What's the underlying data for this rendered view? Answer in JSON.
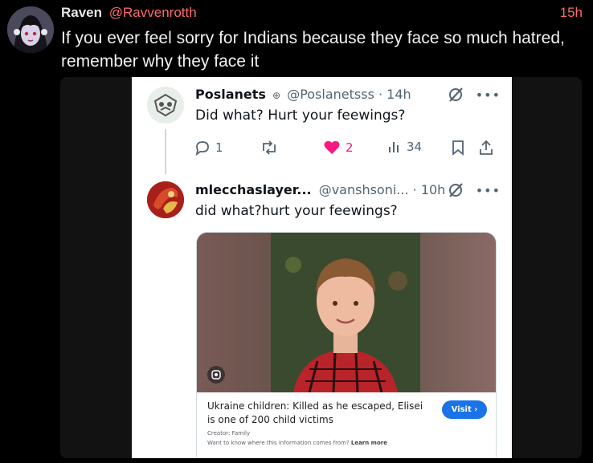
{
  "post": {
    "author_name": "Raven",
    "author_handle": "@Ravvenrotth",
    "time": "15h",
    "text": "If you ever feel sorry for Indians because they face so much hatred, remember why they face it"
  },
  "embedded_screenshot": {
    "tweet1": {
      "name": "Poslanets",
      "handle": "@Poslanetsss · 14h",
      "text": "Did what? Hurt your feewings?",
      "replies": "1",
      "likes": "2",
      "views": "34"
    },
    "tweet2": {
      "name": "mlecchaslayer...",
      "handle": "@vanshsoni... · 10h",
      "text": "did what?hurt your feewings?"
    },
    "card": {
      "caption": "Ukraine children: Killed as he escaped, Elisei is one of 200 child victims",
      "visit_label": "Visit ›",
      "creator": "Creator: Family",
      "know_text": "Want to know where this information comes from?",
      "learn_more": "Learn more"
    }
  },
  "colors": {
    "accent": "#ff6b6b",
    "like": "#f91880",
    "visit": "#1a73e8"
  }
}
